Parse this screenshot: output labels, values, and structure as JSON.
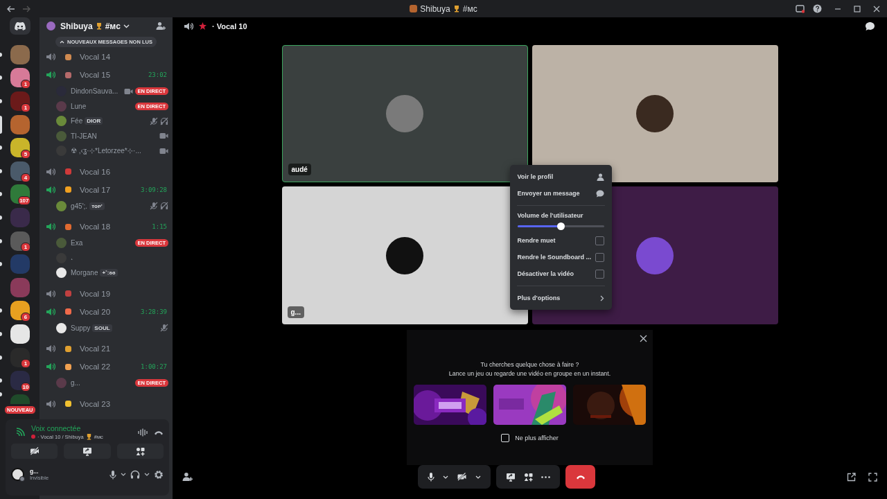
{
  "title_bar": {
    "name": "Shibuya",
    "suffix": "#ᴍᴄ"
  },
  "servers": [
    {
      "selected": false,
      "unread": true,
      "color": "#8b6a4c"
    },
    {
      "selected": false,
      "unread": true,
      "color": "#d77a98",
      "badge": "1"
    },
    {
      "selected": false,
      "unread": true,
      "color": "#6b1a1a",
      "badge": "1"
    },
    {
      "selected": true,
      "color": "#b5642f"
    },
    {
      "selected": false,
      "unread": true,
      "color": "#c9b52a",
      "badge": "5"
    },
    {
      "selected": false,
      "unread": true,
      "color": "#4a5a6a",
      "badge": "4"
    },
    {
      "selected": false,
      "unread": true,
      "color": "#2f7a3a",
      "badge": "107"
    },
    {
      "selected": false,
      "unread": true,
      "color": "#3a2a4a"
    },
    {
      "selected": false,
      "unread": true,
      "color": "#5a5a5a",
      "badge": "1"
    },
    {
      "selected": false,
      "unread": true,
      "color": "#233a66"
    },
    {
      "selected": false,
      "unread": false,
      "color": "#8a3a5a"
    },
    {
      "selected": false,
      "unread": true,
      "color": "#e8a020",
      "badge": "6"
    },
    {
      "selected": false,
      "unread": true,
      "color": "#e6e6e6"
    },
    {
      "selected": false,
      "unread": true,
      "color": "#2a2a2a",
      "badge": "1"
    },
    {
      "selected": false,
      "unread": true,
      "color": "#2a2a44",
      "badge": "10"
    },
    {
      "selected": false,
      "unread": true,
      "color": "#1f4a2a",
      "badge": "NOUVEAU"
    }
  ],
  "server_header": {
    "name": "Shibuya",
    "suffix": "#ᴍᴄ"
  },
  "unread_pill": "NOUVEAUX MESSAGES NON LUS",
  "channels": [
    {
      "name": "Vocal 14",
      "color": "#d08a50"
    },
    {
      "name": "Vocal 15",
      "color": "#b56a6a",
      "timer": "23:02",
      "users": [
        {
          "name": "DindonSauva...",
          "live": "EN DIRECT",
          "video": true,
          "muted": false,
          "deafened": false
        },
        {
          "name": "Lune",
          "live": "EN DIRECT",
          "video": false,
          "muted": false,
          "deafened": false
        },
        {
          "name": "Fée",
          "tag": "DIOR",
          "video": false,
          "muted": true,
          "deafened": true
        },
        {
          "name": "TI-JEAN",
          "video": true,
          "muted": false,
          "deafened": false
        },
        {
          "name": "☢ ,‹ʓ·⊹*Letorzee*⊹·...",
          "video": true,
          "muted": false,
          "deafened": false
        }
      ]
    },
    {
      "name": "Vocal 16",
      "color": "#d03a3a"
    },
    {
      "name": "Vocal 17",
      "color": "#f0a020",
      "timer": "3:09:28",
      "users": [
        {
          "name": "g45';.",
          "tag": "ᴛᴏᴘ'",
          "video": false,
          "muted": true,
          "deafened": true
        }
      ]
    },
    {
      "name": "Vocal 18",
      "color": "#e06a30",
      "timer": "1:15",
      "users": [
        {
          "name": "Exa",
          "live": "EN DIRECT",
          "video": false,
          "muted": false,
          "deafened": false
        },
        {
          "name": "˖",
          "video": false,
          "muted": false,
          "deafened": false
        },
        {
          "name": "Morgane",
          "tag": "+˚:ʚɞ",
          "video": false,
          "muted": false,
          "deafened": false
        }
      ]
    },
    {
      "name": "Vocal 19",
      "color": "#c04040"
    },
    {
      "name": "Vocal 20",
      "color": "#f06a4a",
      "timer": "3:28:39",
      "users": [
        {
          "name": "Suppy",
          "tag": "SOUL",
          "video": false,
          "muted": true,
          "deafened": false
        }
      ]
    },
    {
      "name": "Vocal 21",
      "color": "#e0a030"
    },
    {
      "name": "Vocal 22",
      "color": "#f0a050",
      "timer": "1:00:27",
      "users": [
        {
          "name": "g...",
          "live": "EN DIRECT",
          "video": false,
          "muted": false,
          "deafened": false
        }
      ]
    },
    {
      "name": "Vocal 23",
      "color": "#f0c030"
    }
  ],
  "voice_panel": {
    "status": "Voix connectée",
    "channel": "· Vocal 10 / Shibuya",
    "suffix": "#ᴍᴄ"
  },
  "user_panel": {
    "name": "g...",
    "status": "Invisible"
  },
  "call": {
    "channel": "· Vocal 10",
    "tiles": [
      {
        "name": "audé",
        "speaking": true,
        "color": "#3a403f"
      },
      {
        "speaking": false,
        "color": "#bcb2a6"
      },
      {
        "name": "g...",
        "speaking": false,
        "color": "#d5d5d5"
      },
      {
        "speaking": false,
        "color": "#3e1c46"
      }
    ]
  },
  "context_menu": [
    {
      "kind": "action",
      "label": "Voir le profil"
    },
    {
      "kind": "action",
      "label": "Envoyer un message"
    },
    {
      "kind": "divider"
    },
    {
      "kind": "slider",
      "label": "Volume de l'utilisateur",
      "level": 0.5
    },
    {
      "kind": "checkbox",
      "label": "Rendre muet",
      "checked": false
    },
    {
      "kind": "checkbox",
      "label": "Rendre le Soundboard ...",
      "checked": false
    },
    {
      "kind": "checkbox",
      "label": "Désactiver la vidéo",
      "checked": false
    },
    {
      "kind": "divider"
    },
    {
      "kind": "submenu",
      "label": "Plus d'options"
    }
  ],
  "activity_panel": {
    "title": "Tu cherches quelque chose à faire ?",
    "subtitle": "Lance un jeu ou regarde une vidéo en groupe en un instant.",
    "opt_out": {
      "label": "Ne plus afficher",
      "checked": false
    }
  }
}
